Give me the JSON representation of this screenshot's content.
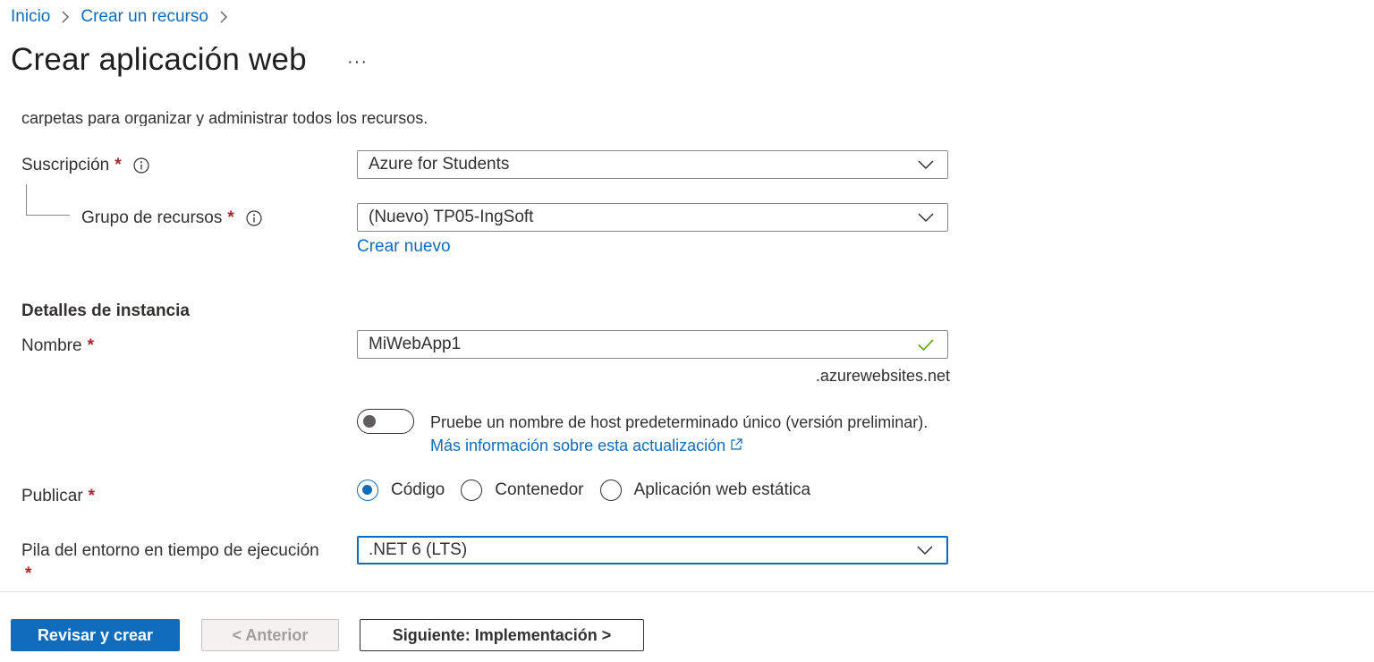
{
  "breadcrumb": {
    "home": "Inicio",
    "create": "Crear un recurso"
  },
  "page": {
    "title": "Crear aplicación web",
    "more": "···",
    "cut_text": "carpetas para organizar y administrar todos los recursos."
  },
  "subscription": {
    "label": "Suscripción",
    "required": "*",
    "value": "Azure for Students"
  },
  "resource_group": {
    "label": "Grupo de recursos",
    "required": "*",
    "value": "(Nuevo) TP05-IngSoft",
    "create_new": "Crear nuevo"
  },
  "instance": {
    "section_title": "Detalles de instancia",
    "name_label": "Nombre",
    "name_required": "*",
    "name_value": "MiWebApp1",
    "suffix": ".azurewebsites.net",
    "toggle_text": "Pruebe un nombre de host predeterminado único (versión preliminar).",
    "toggle_link": "Más información sobre esta actualización",
    "toggle_on": false
  },
  "publish": {
    "label": "Publicar",
    "required": "*",
    "options": [
      "Código",
      "Contenedor",
      "Aplicación web estática"
    ],
    "selected": "Código"
  },
  "runtime": {
    "label": "Pila del entorno en tiempo de ejecución",
    "required": "*",
    "value": ".NET 6 (LTS)"
  },
  "footer": {
    "review": "Revisar y crear",
    "previous": "< Anterior",
    "next": "Siguiente: Implementación >"
  },
  "colors": {
    "accent": "#0f6cbd",
    "required": "#a4262c",
    "valid": "#57a300"
  }
}
